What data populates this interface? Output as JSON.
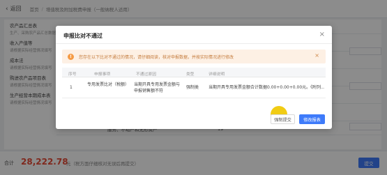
{
  "header": {
    "back_label": "返回",
    "breadcrumbs": [
      "首页",
      "增值税及附加税费申报（一般纳税人适用）"
    ]
  },
  "background": {
    "left_items": [
      {
        "title": "农产品汇总表",
        "sub": "生产、采购农产品汇总数据"
      },
      {
        "title": "收入产值等",
        "sub": "请根据实际经营情况填写"
      },
      {
        "title": "成本法",
        "sub": "请根据实际经营情况填写"
      },
      {
        "title": "购进农产品项目表",
        "sub": "请根据实际经营情况填写"
      },
      {
        "title": "生产经营本期成本表",
        "sub": "请根据实际经营情况填写"
      }
    ],
    "row_text": "服务、不动产和无形资产",
    "row_number": "19"
  },
  "footer": {
    "total_label": "合计",
    "total_value": "28,222.78",
    "total_note": "元（税方面仔细核对无误后再提交）",
    "submit_label": "提交"
  },
  "dialog": {
    "title": "申报比对不通过",
    "alert_text": "您存在以下比对不通过的情况，请仔细阅读，核对申报数据，并按实际情况进行修改",
    "columns": [
      "序号",
      "申报事项",
      "不通过原因",
      "类型",
      "详细说明"
    ],
    "rows": [
      {
        "index": "1",
        "item": "专用发票比对（税额）",
        "reason": "当期开具专用发票金额与申报销售额不符",
        "type": "强制类",
        "detail": "当期开具专用发票金额合计数据0.00+0.00+0.00元。《附列..."
      }
    ],
    "ignore_label": "强制提交",
    "modify_label": "修改报表"
  },
  "colors": {
    "accent": "#3e7bfa",
    "total_red": "#e84b37",
    "alert_bg": "#fdf0e4",
    "alert_icon": "#f59b45",
    "cursor_highlight": "#f0c800"
  }
}
